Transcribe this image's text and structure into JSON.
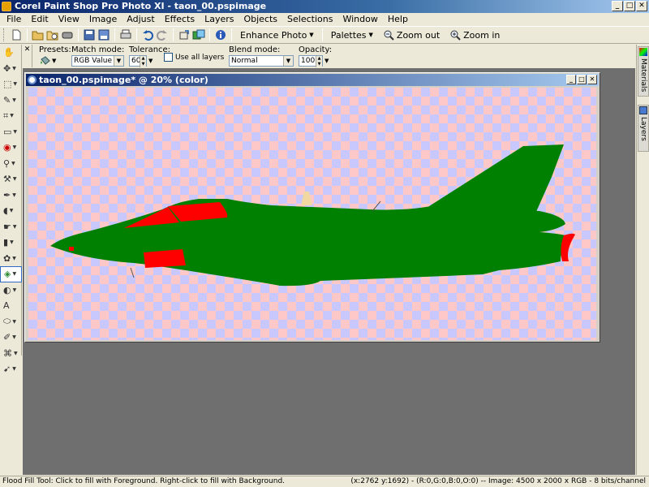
{
  "window": {
    "title": "Corel Paint Shop Pro Photo XI - taon_00.pspimage",
    "btn_min": "_",
    "btn_max": "□",
    "btn_close": "✕"
  },
  "menu": [
    "File",
    "Edit",
    "View",
    "Image",
    "Adjust",
    "Effects",
    "Layers",
    "Objects",
    "Selections",
    "Window",
    "Help"
  ],
  "toolbar": {
    "enhance_photo": "Enhance Photo",
    "palettes": "Palettes",
    "zoom_out": "Zoom out",
    "zoom_in": "Zoom in"
  },
  "options": {
    "presets_label": "Presets:",
    "match_mode_label": "Match mode:",
    "match_mode_value": "RGB Value",
    "tolerance_label": "Tolerance:",
    "tolerance_value": "60",
    "use_all_layers_label": "Use all layers",
    "blend_mode_label": "Blend mode:",
    "blend_mode_value": "Normal",
    "opacity_label": "Opacity:",
    "opacity_value": "100"
  },
  "document": {
    "title": "taon_00.pspimage* @ 20% (color)"
  },
  "palettes": {
    "materials": "Materials",
    "layers": "Layers"
  },
  "status": {
    "left": "Flood Fill Tool: Click to fill with Foreground. Right-click to fill with Background.",
    "right": "(x:2762 y:1692) - (R:0,G:0,B:0,O:0) -- Image:  4500 x 2000 x RGB - 8 bits/channel"
  },
  "colors": {
    "fill_green": "#008000",
    "fill_red": "#ff0000",
    "fill_tan": "#f0d8a0",
    "checker_pink": "#ffc8c8",
    "checker_blue": "#c8c8ff"
  },
  "icons": {
    "tools": [
      "pan-icon",
      "move-icon",
      "selection-icon",
      "dropper-icon",
      "crop-icon",
      "straighten-icon",
      "red-eye-icon",
      "clone-icon",
      "scratch-remover-icon",
      "paint-brush-icon",
      "dodge-icon",
      "smudge-icon",
      "eraser-icon",
      "picture-tube-icon",
      "flood-fill-icon",
      "color-replacer-icon",
      "text-icon",
      "preset-shape-icon",
      "pen-icon",
      "warp-brush-icon",
      "pick-icon"
    ]
  }
}
